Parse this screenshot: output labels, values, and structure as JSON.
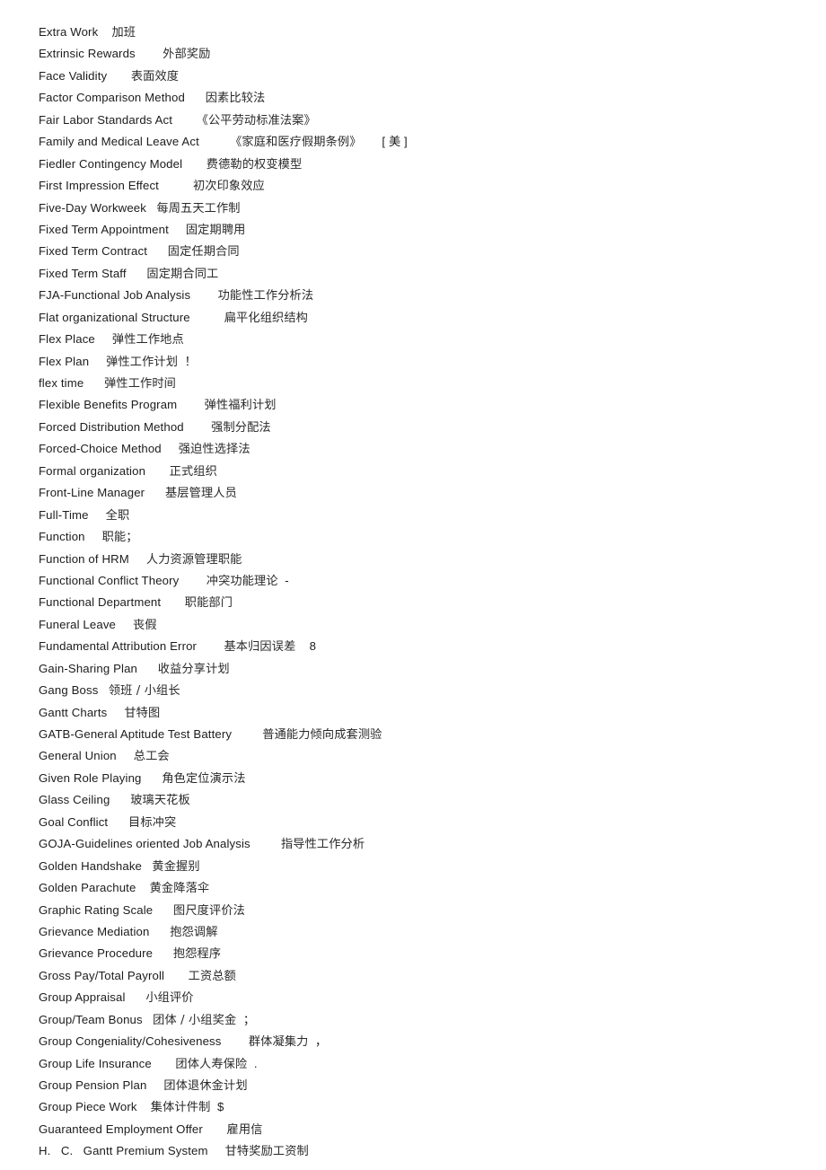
{
  "document": {
    "type": "bilingual-glossary",
    "language_pair": "English-Chinese",
    "section": "F-H",
    "background_color": "#ffffff",
    "text_color": "#1c1c1c"
  },
  "entries": [
    {
      "term": "Extra Work",
      "gap": "    ",
      "translation": "加班",
      "suffix": ""
    },
    {
      "term": "Extrinsic Rewards",
      "gap": "        ",
      "translation": "外部奖励",
      "suffix": ""
    },
    {
      "term": "Face Validity",
      "gap": "       ",
      "translation": "表面效度",
      "suffix": ""
    },
    {
      "term": "Factor Comparison Method",
      "gap": "      ",
      "translation": "因素比较法",
      "suffix": ""
    },
    {
      "term": "Fair Labor Standards Act",
      "gap": "       ",
      "translation": "《公平劳动标准法案》",
      "suffix": ""
    },
    {
      "term": "Family and Medical Leave Act",
      "gap": "         ",
      "translation": "《家庭和医疗假期条例》",
      "suffix": "      [ 美 ]"
    },
    {
      "term": "Fiedler Contingency Model",
      "gap": "       ",
      "translation": "费德勒的权变模型",
      "suffix": ""
    },
    {
      "term": "First Impression Effect",
      "gap": "          ",
      "translation": "初次印象效应",
      "suffix": ""
    },
    {
      "term": "Five-Day Workweek",
      "gap": "   ",
      "translation": "每周五天工作制",
      "suffix": ""
    },
    {
      "term": "Fixed Term Appointment",
      "gap": "     ",
      "translation": "固定期聘用",
      "suffix": ""
    },
    {
      "term": "Fixed Term Contract",
      "gap": "      ",
      "translation": "固定任期合同",
      "suffix": ""
    },
    {
      "term": "Fixed Term Staff",
      "gap": "      ",
      "translation": "固定期合同工",
      "suffix": ""
    },
    {
      "term": "FJA-Functional Job Analysis",
      "gap": "        ",
      "translation": "功能性工作分析法",
      "suffix": ""
    },
    {
      "term": "Flat organizational Structure",
      "gap": "          ",
      "translation": "扁平化组织结构",
      "suffix": ""
    },
    {
      "term": "Flex Place",
      "gap": "     ",
      "translation": "弹性工作地点",
      "suffix": ""
    },
    {
      "term": "Flex Plan",
      "gap": "     ",
      "translation": "弹性工作计划",
      "suffix": "  ！"
    },
    {
      "term": "flex time",
      "gap": "      ",
      "translation": "弹性工作时间",
      "suffix": ""
    },
    {
      "term": "Flexible Benefits Program",
      "gap": "        ",
      "translation": "弹性福利计划",
      "suffix": ""
    },
    {
      "term": "Forced Distribution Method",
      "gap": "        ",
      "translation": "强制分配法",
      "suffix": ""
    },
    {
      "term": "Forced-Choice Method",
      "gap": "     ",
      "translation": "强迫性选择法",
      "suffix": ""
    },
    {
      "term": "Formal organization",
      "gap": "       ",
      "translation": "正式组织",
      "suffix": ""
    },
    {
      "term": "Front-Line Manager",
      "gap": "      ",
      "translation": "基层管理人员",
      "suffix": ""
    },
    {
      "term": "Full-Time",
      "gap": "     ",
      "translation": "全职",
      "suffix": ""
    },
    {
      "term": "Function",
      "gap": "     ",
      "translation": "职能",
      "suffix": "；"
    },
    {
      "term": "Function of HRM",
      "gap": "     ",
      "translation": "人力资源管理职能",
      "suffix": ""
    },
    {
      "term": "Functional Conflict Theory",
      "gap": "        ",
      "translation": "冲突功能理论",
      "suffix": "  -"
    },
    {
      "term": "Functional Department",
      "gap": "       ",
      "translation": "职能部门",
      "suffix": ""
    },
    {
      "term": "Funeral Leave",
      "gap": "     ",
      "translation": "丧假",
      "suffix": ""
    },
    {
      "term": "Fundamental Attribution Error",
      "gap": "        ",
      "translation": "基本归因误差",
      "suffix": "    8"
    },
    {
      "term": "Gain-Sharing Plan",
      "gap": "      ",
      "translation": "收益分享计划",
      "suffix": ""
    },
    {
      "term": "Gang Boss",
      "gap": "   ",
      "translation": "领班 / 小组长",
      "suffix": ""
    },
    {
      "term": "Gantt Charts",
      "gap": "     ",
      "translation": "甘特图",
      "suffix": ""
    },
    {
      "term": "GATB-General Aptitude Test Battery",
      "gap": "         ",
      "translation": "普通能力倾向成套测验",
      "suffix": ""
    },
    {
      "term": "General Union",
      "gap": "     ",
      "translation": "总工会",
      "suffix": ""
    },
    {
      "term": "Given Role Playing",
      "gap": "      ",
      "translation": "角色定位演示法",
      "suffix": ""
    },
    {
      "term": "Glass Ceiling",
      "gap": "      ",
      "translation": "玻璃天花板",
      "suffix": ""
    },
    {
      "term": "Goal Conflict",
      "gap": "      ",
      "translation": "目标冲突",
      "suffix": ""
    },
    {
      "term": "GOJA-Guidelines oriented Job Analysis",
      "gap": "         ",
      "translation": "指导性工作分析",
      "suffix": ""
    },
    {
      "term": "Golden Handshake",
      "gap": "   ",
      "translation": "黄金握别",
      "suffix": ""
    },
    {
      "term": "Golden Parachute",
      "gap": "    ",
      "translation": "黄金降落伞",
      "suffix": ""
    },
    {
      "term": "Graphic Rating Scale",
      "gap": "      ",
      "translation": "图尺度评价法",
      "suffix": ""
    },
    {
      "term": "Grievance Mediation",
      "gap": "      ",
      "translation": "抱怨调解",
      "suffix": ""
    },
    {
      "term": "Grievance Procedure",
      "gap": "      ",
      "translation": "抱怨程序",
      "suffix": ""
    },
    {
      "term": "Gross Pay/Total Payroll",
      "gap": "       ",
      "translation": "工资总额",
      "suffix": ""
    },
    {
      "term": "Group Appraisal",
      "gap": "      ",
      "translation": "小组评价",
      "suffix": ""
    },
    {
      "term": "Group/Team Bonus",
      "gap": "   ",
      "translation": "团体 / 小组奖金",
      "suffix": "  ；"
    },
    {
      "term": "Group Congeniality/Cohesiveness",
      "gap": "        ",
      "translation": "群体凝集力",
      "suffix": "  ，"
    },
    {
      "term": "Group Life Insurance",
      "gap": "       ",
      "translation": "团体人寿保险",
      "suffix": "  ."
    },
    {
      "term": "Group Pension Plan",
      "gap": "     ",
      "translation": "团体退休金计划",
      "suffix": ""
    },
    {
      "term": "Group Piece Work",
      "gap": "    ",
      "translation": "集体计件制",
      "suffix": "  $"
    },
    {
      "term": "Guaranteed Employment Offer",
      "gap": "       ",
      "translation": "雇用信",
      "suffix": ""
    },
    {
      "term": "H.   C.   Gantt Premium System",
      "gap": "     ",
      "translation": "甘特奖励工资制",
      "suffix": ""
    }
  ]
}
